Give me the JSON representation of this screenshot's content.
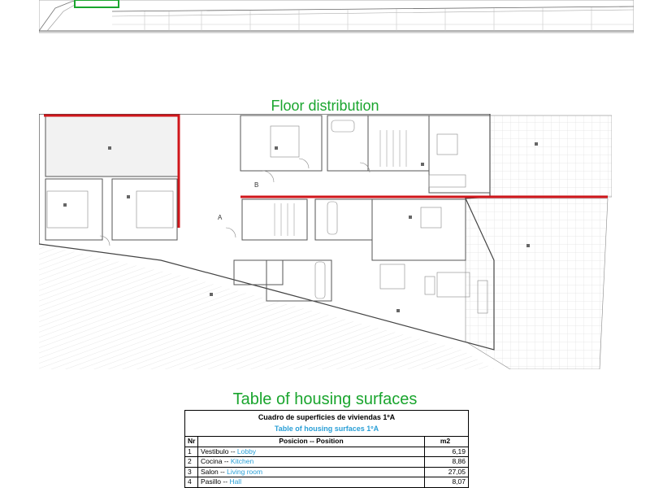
{
  "floor_distribution": {
    "title": "Floor distribution",
    "labels": {
      "a": "A",
      "b": "B"
    }
  },
  "housing_surfaces": {
    "title": "Table of housing surfaces",
    "table": {
      "title_es": "Cuadro de superficies de viviendas 1ºA",
      "title_en": "Table of housing surfaces 1ºA",
      "headers": {
        "nr": "Nr",
        "position": "Posicion -- Position",
        "m2": "m2"
      },
      "rows": [
        {
          "nr": "1",
          "es": "Vestibulo -- ",
          "en": "Lobby",
          "m2": "6,19"
        },
        {
          "nr": "2",
          "es": "Cocina --  ",
          "en": "Kitchen",
          "m2": "8,86"
        },
        {
          "nr": "3",
          "es": "Salon -- ",
          "en": "Living room",
          "m2": "27,05"
        },
        {
          "nr": "4",
          "es": "Pasillo -- ",
          "en": "Hall",
          "m2": "8,07"
        }
      ]
    }
  },
  "colors": {
    "accent_green": "#1aa52e",
    "accent_blue": "#2a9fd6",
    "wall_red": "#d0161b"
  }
}
